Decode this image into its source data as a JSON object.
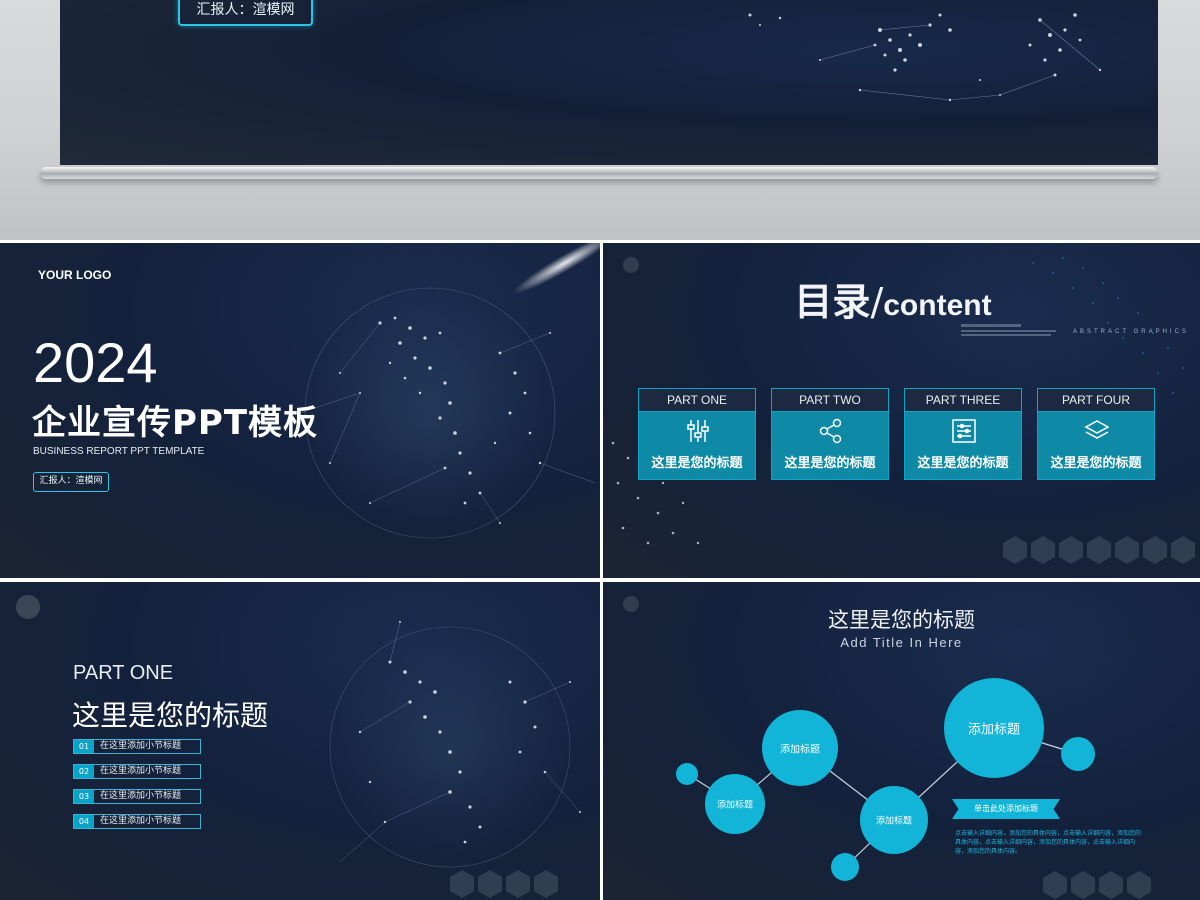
{
  "preview": {
    "reporter_badge": "汇报人：渲模网"
  },
  "slide1": {
    "logo": "YOUR LOGO",
    "year": "2024",
    "title": "企业宣传PPT模板",
    "subtitle": "BUSINESS REPORT PPT TEMPLATE",
    "reporter_badge": "汇报人：渲模网"
  },
  "slide2": {
    "title_cn": "目录",
    "title_sep": "/",
    "title_en": "content",
    "deco_text": "ABSTRACT GRAPHICS",
    "cards": [
      {
        "head": "PART ONE",
        "label": "这里是您的标题",
        "icon": "sliders-icon"
      },
      {
        "head": "PART TWO",
        "label": "这里是您的标题",
        "icon": "share-icon"
      },
      {
        "head": "PART THREE",
        "label": "这里是您的标题",
        "icon": "list-icon"
      },
      {
        "head": "PART FOUR",
        "label": "这里是您的标题",
        "icon": "layers-icon"
      }
    ]
  },
  "slide3": {
    "part": "PART ONE",
    "title": "这里是您的标题",
    "items": [
      {
        "num": "01",
        "text": "在这里添加小节标题"
      },
      {
        "num": "02",
        "text": "在这里添加小节标题"
      },
      {
        "num": "03",
        "text": "在这里添加小节标题"
      },
      {
        "num": "04",
        "text": "在这里添加小节标题"
      }
    ]
  },
  "slide4": {
    "title": "这里是您的标题",
    "subtitle": "Add Title In Here",
    "circles": [
      "添加标题",
      "添加标题",
      "添加标题",
      "添加标题"
    ],
    "ribbon": "单击此处添加标题",
    "body": "点击输入详细内容，添加您的具体内容，点击输入详细内容，添加您的具体内容，点击输入详细内容，添加您的具体内容，点击输入详细内容，添加您的具体内容。"
  },
  "colors": {
    "accent": "#12b5d7",
    "card_body": "#0e8aa6",
    "bg_dark": "#13213c"
  }
}
